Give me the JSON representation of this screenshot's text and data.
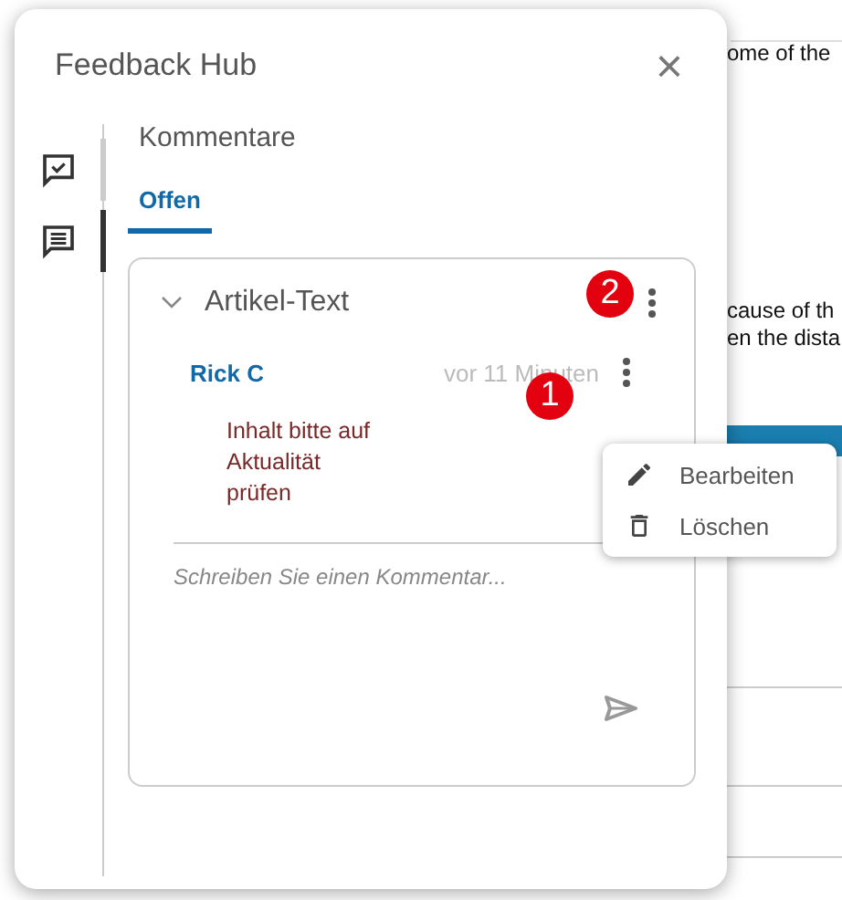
{
  "document": {
    "lines": [
      "ome of the",
      "cause of th",
      "en the dista"
    ]
  },
  "panel": {
    "title": "Feedback Hub",
    "close": "×",
    "section_title": "Kommentare",
    "rail": [
      {
        "kind": "review",
        "selected": false
      },
      {
        "kind": "comments",
        "selected": true
      }
    ],
    "tabs": [
      {
        "label": "Offen",
        "selected": true
      }
    ],
    "thread": {
      "title": "Artikel-Text",
      "expanded": true,
      "badge": "2",
      "comments": [
        {
          "author": "Rick C",
          "time": "vor 11 Minuten",
          "badge": "1",
          "text": "Inhalt bitte auf Aktualität prüfen"
        }
      ],
      "reply": {
        "placeholder": "Schreiben Sie einen Kommentar..."
      }
    }
  },
  "menu": {
    "items": [
      {
        "kind": "edit",
        "label": "Bearbeiten"
      },
      {
        "kind": "delete",
        "label": "Löschen"
      }
    ]
  }
}
